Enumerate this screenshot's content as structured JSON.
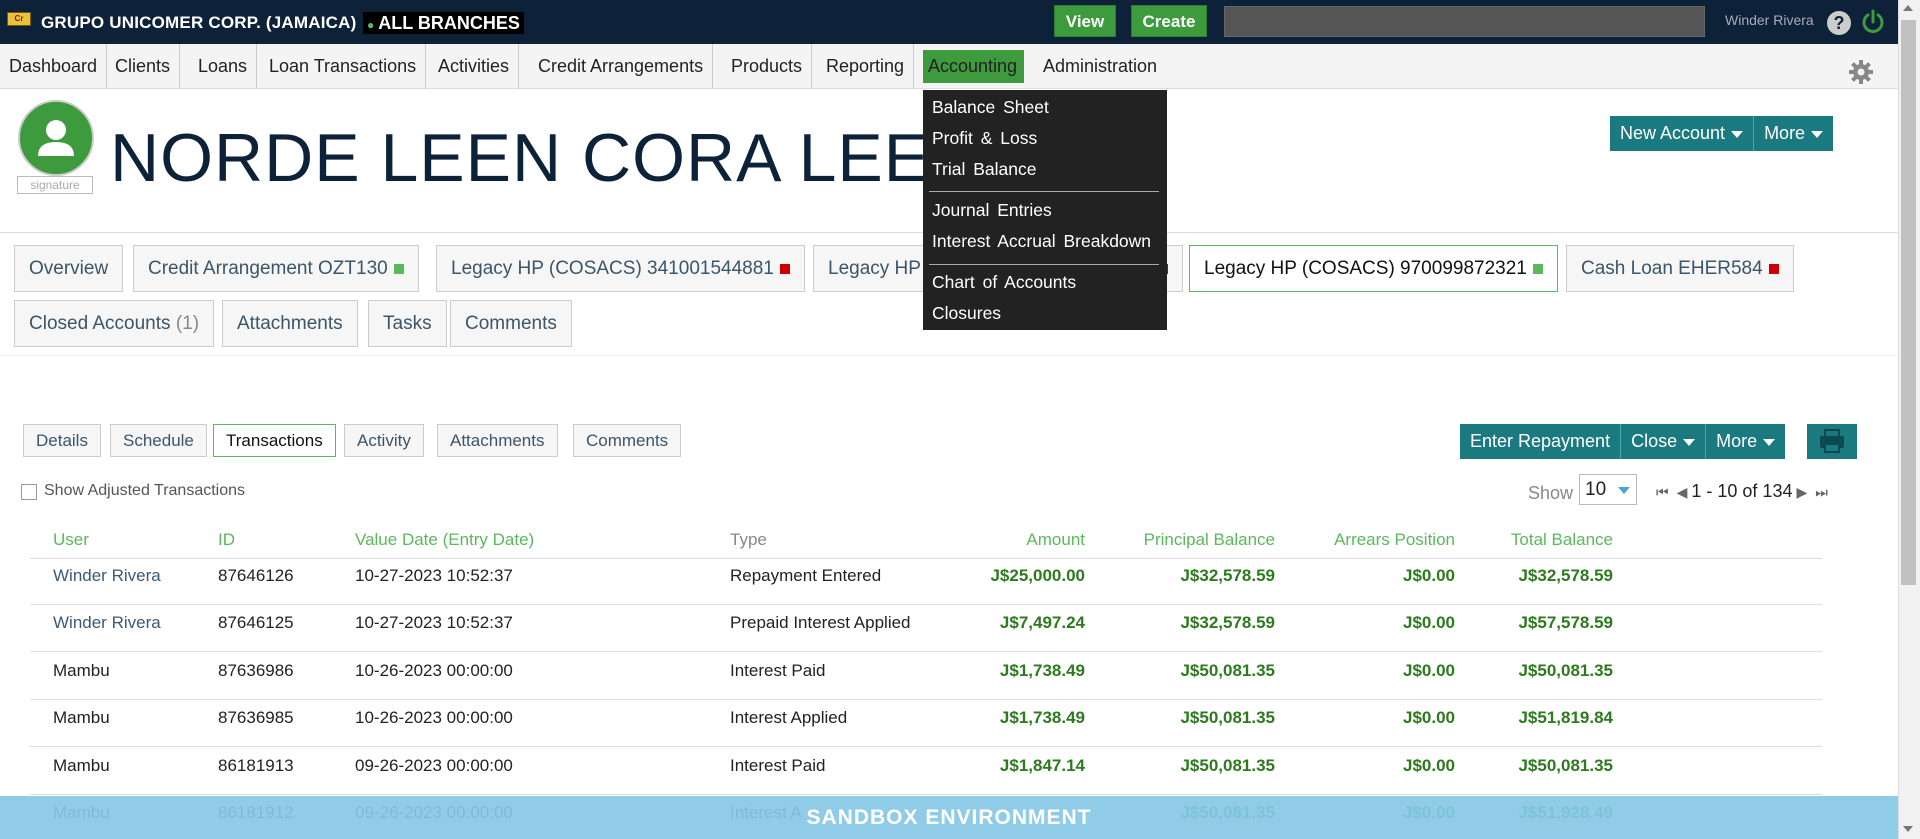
{
  "header": {
    "org": "GRUPO UNICOMER CORP. (JAMAICA)",
    "branch": "ALL BRANCHES",
    "view_label": "View",
    "create_label": "Create",
    "search_placeholder": "",
    "user": "Winder Rivera",
    "help": "?"
  },
  "nav": {
    "items": [
      "Dashboard",
      "Clients",
      "Loans",
      "Loan Transactions",
      "Activities",
      "Credit Arrangements",
      "Products",
      "Reporting",
      "Accounting",
      "Administration"
    ],
    "active": "Accounting"
  },
  "accounting_menu": {
    "items": [
      "Balance Sheet",
      "Profit & Loss",
      "Trial Balance",
      "Journal Entries",
      "Interest Accrual Breakdown",
      "Chart of Accounts",
      "Closures"
    ]
  },
  "client": {
    "name": "NORDE LEEN CORA LEE P SI",
    "signature_label": "signature",
    "new_account_label": "New Account",
    "more_label": "More"
  },
  "tabs": {
    "overview": "Overview",
    "credit_arrangement": "Credit Arrangement OZT130",
    "legacy1": "Legacy HP (COSACS) 341001544881",
    "legacy2": "Legacy HP",
    "legacy3": "Legacy HP (COSACS) 970099872321",
    "cash_loan": "Cash Loan EHER584",
    "closed_accounts": "Closed Accounts",
    "closed_count": "(1)",
    "attachments": "Attachments",
    "tasks": "Tasks",
    "comments": "Comments"
  },
  "subtabs": {
    "details": "Details",
    "schedule": "Schedule",
    "transactions": "Transactions",
    "activity": "Activity",
    "attachments": "Attachments",
    "comments": "Comments"
  },
  "actions": {
    "enter_repayment": "Enter Repayment",
    "close": "Close",
    "more": "More"
  },
  "filters": {
    "show_adjusted": "Show Adjusted Transactions",
    "show_label": "Show",
    "page_size": "10",
    "range": "1 - 10 of 134"
  },
  "table": {
    "headers": {
      "user": "User",
      "id": "ID",
      "value_date": "Value Date (Entry Date)",
      "type": "Type",
      "amount": "Amount",
      "principal_balance": "Principal Balance",
      "arrears_position": "Arrears Position",
      "total_balance": "Total Balance"
    },
    "rows": [
      {
        "user": "Winder Rivera",
        "id": "87646126",
        "date": "10-27-2023 10:52:37",
        "type": "Repayment Entered",
        "amount": "J$25,000.00",
        "principal": "J$32,578.59",
        "arrears": "J$0.00",
        "total": "J$32,578.59"
      },
      {
        "user": "Winder Rivera",
        "id": "87646125",
        "date": "10-27-2023 10:52:37",
        "type": "Prepaid Interest Applied",
        "amount": "J$7,497.24",
        "principal": "J$32,578.59",
        "arrears": "J$0.00",
        "total": "J$57,578.59"
      },
      {
        "user": "Mambu",
        "id": "87636986",
        "date": "10-26-2023 00:00:00",
        "type": "Interest Paid",
        "amount": "J$1,738.49",
        "principal": "J$50,081.35",
        "arrears": "J$0.00",
        "total": "J$50,081.35"
      },
      {
        "user": "Mambu",
        "id": "87636985",
        "date": "10-26-2023 00:00:00",
        "type": "Interest Applied",
        "amount": "J$1,738.49",
        "principal": "J$50,081.35",
        "arrears": "J$0.00",
        "total": "J$51,819.84"
      },
      {
        "user": "Mambu",
        "id": "86181913",
        "date": "09-26-2023 00:00:00",
        "type": "Interest Paid",
        "amount": "J$1,847.14",
        "principal": "J$50,081.35",
        "arrears": "J$0.00",
        "total": "J$50,081.35"
      },
      {
        "user": "Mambu",
        "id": "86181912",
        "date": "09-26-2023 00:00:00",
        "type": "Interest A",
        "amount": "",
        "principal": "J$50,081.35",
        "arrears": "J$0.00",
        "total": "J$51,928.49"
      }
    ]
  },
  "banner": "SANDBOX ENVIRONMENT",
  "colors": {
    "topbar": "#0d2238",
    "accent": "#3d9a3d",
    "teal": "#1a7a80",
    "money": "#2d7a1f",
    "banner": "#87c8e6"
  }
}
